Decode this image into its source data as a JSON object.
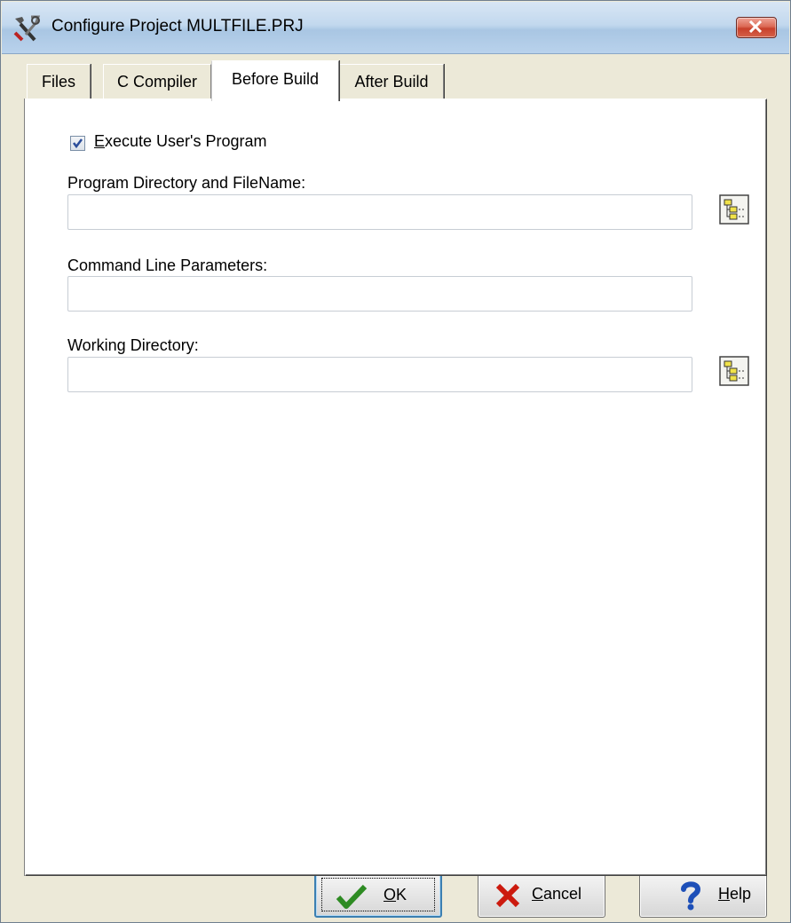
{
  "window": {
    "title": "Configure Project MULTFILE.PRJ",
    "app_icon": "tools-icon",
    "close_icon": "close-icon"
  },
  "tabs": [
    {
      "label": "Files",
      "active": false
    },
    {
      "label": "C Compiler",
      "active": false
    },
    {
      "label": "Before Build",
      "active": true
    },
    {
      "label": "After Build",
      "active": false
    }
  ],
  "panel": {
    "execute_checkbox": {
      "label_prefix": "E",
      "label_rest": "xecute User's Program",
      "checked": true
    },
    "program_dir": {
      "label": "Program Directory and FileName:",
      "value": "",
      "browse_icon": "folder-tree-icon"
    },
    "command_line": {
      "label": "Command Line Parameters:",
      "value": ""
    },
    "working_dir": {
      "label": "Working Directory:",
      "value": "",
      "browse_icon": "folder-tree-icon"
    }
  },
  "buttons": {
    "ok": {
      "mnemonic": "O",
      "rest": "K",
      "icon": "checkmark-icon",
      "icon_color": "#2e8b23"
    },
    "cancel": {
      "mnemonic": "C",
      "rest": "ancel",
      "icon": "x-icon",
      "icon_color": "#cc1a0e"
    },
    "help": {
      "mnemonic": "H",
      "rest": "elp",
      "icon": "question-icon",
      "icon_color": "#1d4fb8"
    }
  }
}
